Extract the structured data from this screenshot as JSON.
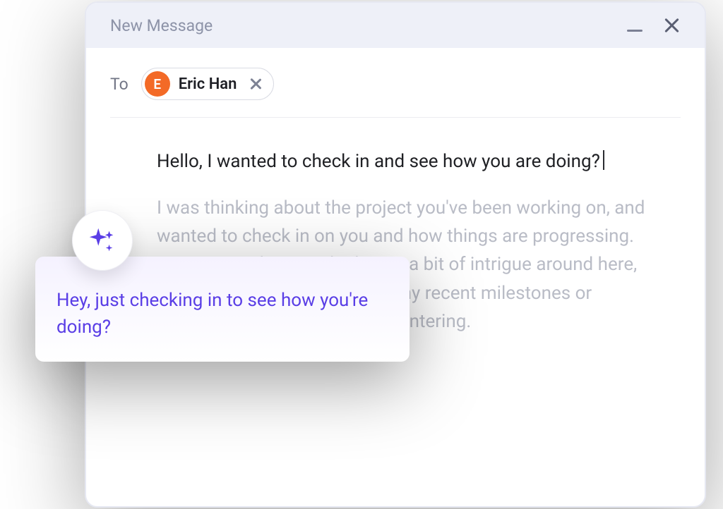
{
  "window": {
    "title": "New Message"
  },
  "to": {
    "label": "To",
    "recipient": {
      "initial": "E",
      "name": "Eric Han"
    }
  },
  "body": {
    "main": "Hello, I wanted to check in and see how you are doing?",
    "faded": "I was thinking about the project you've been working on, and wanted to check in on you and how things are progressing. Your project has sparked quite a bit of intrigue around here, and I'm eager to know about any recent milestones or challenges you might be encountering."
  },
  "suggestion": {
    "text": "Hey, just checking in to see how you're doing?"
  },
  "colors": {
    "accent": "#5a3ee6",
    "avatar": "#f36a27",
    "headerBg": "#eef0f8",
    "mutedText": "#8d93a8",
    "fadedText": "#b9bcc6"
  }
}
